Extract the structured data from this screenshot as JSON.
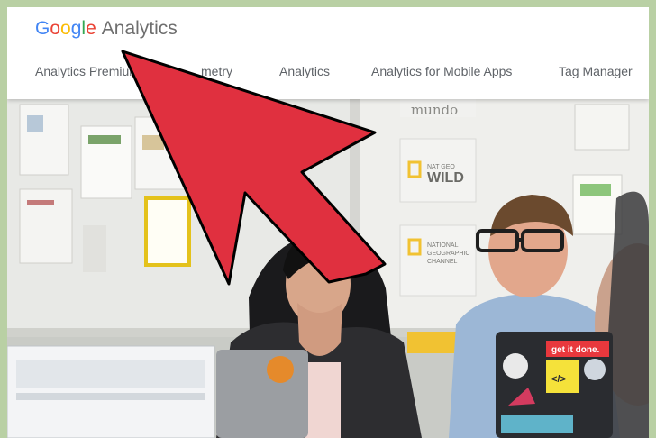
{
  "header": {
    "logo": {
      "google_letters": [
        "G",
        "o",
        "o",
        "g",
        "l",
        "e"
      ],
      "product": "Analytics"
    },
    "nav": [
      {
        "label": "Analytics Premium"
      },
      {
        "label": "metry"
      },
      {
        "label": "Analytics"
      },
      {
        "label": "Analytics for Mobile Apps"
      },
      {
        "label": "Tag Manager"
      }
    ]
  },
  "photo": {
    "signs": {
      "mundo": "mundo",
      "natgeo_wild_small": "NAT GEO",
      "natgeo_wild": "WILD",
      "natgeo_channel_1": "NATIONAL",
      "natgeo_channel_2": "GEOGRAPHIC",
      "natgeo_channel_3": "CHANNEL"
    },
    "sticker_get_it_done": "get it done.",
    "sticker_code": "</>"
  },
  "colors": {
    "arrow_fill": "#e0303f",
    "arrow_outline": "#000000",
    "border": "#b9d0a4"
  }
}
